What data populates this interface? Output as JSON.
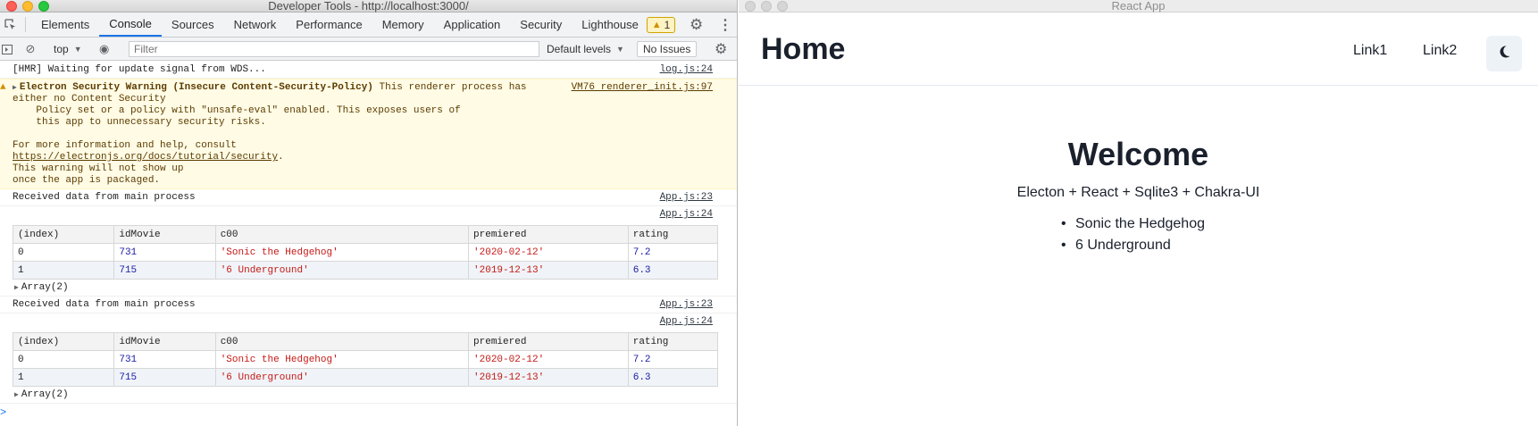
{
  "devtools": {
    "window_title": "Developer Tools - http://localhost:3000/",
    "tabs": [
      "Elements",
      "Console",
      "Sources",
      "Network",
      "Performance",
      "Memory",
      "Application",
      "Security",
      "Lighthouse"
    ],
    "active_tab": "Console",
    "warning_count": "1",
    "toolbar": {
      "context": "top",
      "filter_placeholder": "Filter",
      "levels": "Default levels",
      "issues": "No Issues"
    },
    "console": {
      "hmr": {
        "text": "[HMR] Waiting for update signal from WDS...",
        "source": "log.js:24"
      },
      "warning": {
        "headline": "Electron Security Warning (Insecure Content-Security-Policy)",
        "line1_rest": " This renderer process has",
        "body1": "either no Content Security\n    Policy set or a policy with \"unsafe-eval\" enabled. This exposes users of\n    this app to unnecessary security risks.\n\nFor more information and help, consult\n",
        "link": "https://electronjs.org/docs/tutorial/security",
        "body2": ".\nThis warning will not show up\nonce the app is packaged.",
        "source": "VM76 renderer_init.js:97"
      },
      "log_text": "Received data from main process",
      "log_source": "App.js:23",
      "table_source": "App.js:24",
      "table_headers": [
        "(index)",
        "idMovie",
        "c00",
        "premiered",
        "rating"
      ],
      "table_rows": [
        [
          "0",
          "731",
          "'Sonic the Hedgehog'",
          "'2020-02-12'",
          "7.2"
        ],
        [
          "1",
          "715",
          "'6 Underground'",
          "'2019-12-13'",
          "6.3"
        ]
      ],
      "array_label": "Array(2)",
      "prompt": ">"
    }
  },
  "app": {
    "window_title": "React App",
    "brand": "Home",
    "links": [
      "Link1",
      "Link2"
    ],
    "heading": "Welcome",
    "subtitle": "Electon + React + Sqlite3 + Chakra-UI",
    "movies": [
      "Sonic the Hedgehog",
      "6 Underground"
    ]
  },
  "colors": {
    "accent": "#1a73e8",
    "warning_bg": "#fffbe5",
    "string_value": "#c41a16",
    "number_value": "#1a1aa6",
    "app_text": "#1a202c"
  },
  "icons": {
    "inspect": "inspect-element-icon",
    "warning": "warning-triangle-icon",
    "settings": "gear-icon",
    "menu": "kebab-menu-icon",
    "sidebar": "console-sidebar-icon",
    "clear": "clear-console-icon",
    "live_expression": "eye-icon",
    "color_mode": "moon-icon"
  }
}
